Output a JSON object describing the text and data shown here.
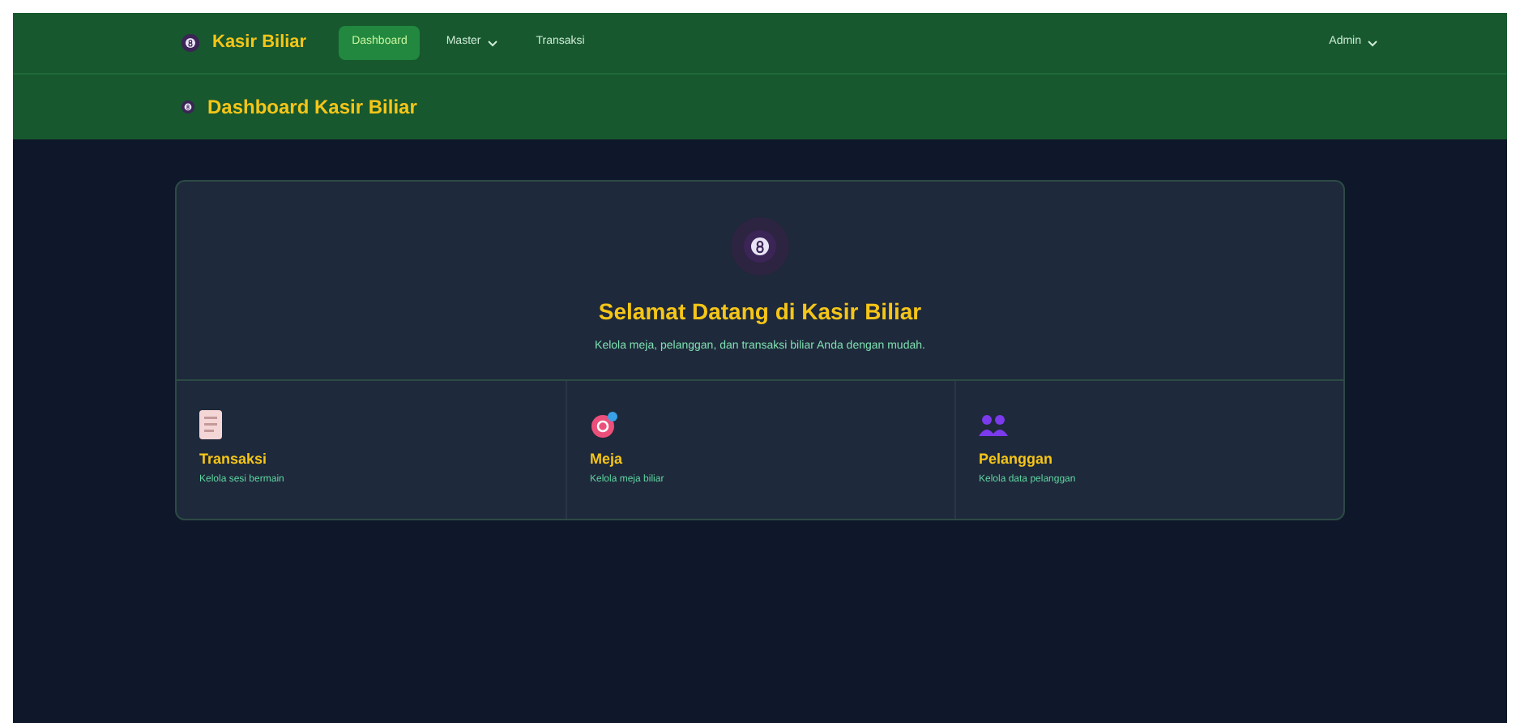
{
  "navbar": {
    "brand": "Kasir Biliar",
    "items": [
      {
        "label": "Dashboard",
        "selected": true,
        "dropdown": false
      },
      {
        "label": "Master",
        "selected": false,
        "dropdown": true
      },
      {
        "label": "Transaksi",
        "selected": false,
        "dropdown": false
      }
    ],
    "user": "Admin"
  },
  "header": {
    "title": "Dashboard Kasir Biliar"
  },
  "welcome": {
    "title": "Selamat Datang di Kasir Biliar",
    "subtitle": "Kelola meja, pelanggan, dan transaksi biliar Anda dengan mudah."
  },
  "menu_cards": [
    {
      "kind": "receipt",
      "title": "Transaksi",
      "description": "Kelola sesi bermain"
    },
    {
      "kind": "target",
      "title": "Meja",
      "description": "Kelola meja biliar"
    },
    {
      "kind": "people",
      "title": "Pelanggan",
      "description": "Kelola data pelanggan"
    }
  ]
}
